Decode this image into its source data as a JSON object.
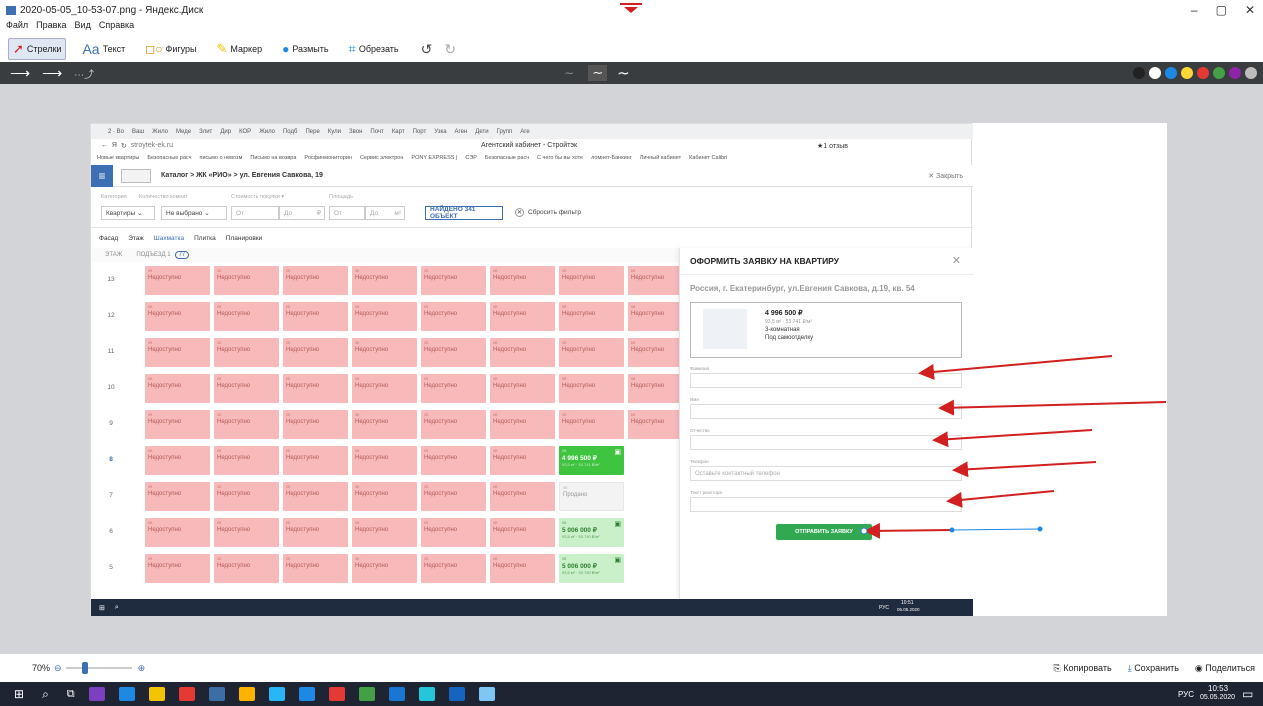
{
  "window": {
    "title": "2020-05-05_10-53-07.png - Яндекс.Диск",
    "controls": [
      "–",
      "▢",
      "✕"
    ]
  },
  "menu": [
    "Файл",
    "Правка",
    "Вид",
    "Справка"
  ],
  "toolbar": {
    "arrows": "Стрелки",
    "text": "Текст",
    "shapes": "Фигуры",
    "marker": "Маркер",
    "blur": "Размыть",
    "crop": "Обрезать"
  },
  "palette": [
    "#222222",
    "#ffffff",
    "#1e88e5",
    "#fdd835",
    "#e53935",
    "#43a047",
    "#8e24aa",
    "#bdbdbd"
  ],
  "browser": {
    "tabs": [
      "2 · Во",
      "Ваш",
      "Жило",
      "Меде",
      "Злит",
      "Дир",
      "КОР",
      "Жило",
      "Подб",
      "Пере",
      "Кули",
      "Звон",
      "Почт",
      "Карт",
      "Порт",
      "Узка",
      "Аген",
      "Дети",
      "Групп",
      "Аге"
    ],
    "url": "stroytek-ek.ru",
    "page_title": "Агентский кабинет - Стройтэк",
    "reviews": "★1 отзыв",
    "bookmarks": [
      "Новые квартиры",
      "Безопасные расч",
      "письмо о невозм",
      "Письмо на возвра",
      "Росфинмониторин",
      "Сервис электрон",
      "PONY EXPRESS |",
      "СЭР",
      "Безопасные расч",
      "С чего бы вы хоте",
      "ломнет-Банкинг",
      "Личный кабинет",
      "Кабинет Сalibri"
    ]
  },
  "site": {
    "breadcrumb": [
      "Каталог",
      "ЖК «РИО»",
      "ул. Евгения Савкова, 19"
    ],
    "close": "✕ Закрыть",
    "filters": {
      "labels": [
        "Категория",
        "Количество комнат",
        "Стоимость покупки ▾",
        "Площадь"
      ],
      "category": "Квартиры",
      "rooms": "Не выбрано",
      "from": "От",
      "to": "До",
      "rub": "₽",
      "m2": "м²",
      "found": "НАЙДЕНО 341 ОБЪЕКТ",
      "reset": "Сбросить фильтр"
    },
    "views": [
      "Фасад",
      "Этаж",
      "Шахматка",
      "Плитка",
      "Планировки"
    ],
    "floor_header": {
      "label": "ЭТАЖ",
      "entrance": "ПОДЪЕЗД 1",
      "count": "77"
    }
  },
  "floors": [
    {
      "num": "13",
      "cells": [
        "u",
        "u",
        "u",
        "u",
        "u",
        "u",
        "u",
        "u"
      ]
    },
    {
      "num": "12",
      "cells": [
        "u",
        "u",
        "u",
        "u",
        "u",
        "u",
        "u",
        "u"
      ]
    },
    {
      "num": "11",
      "cells": [
        "u",
        "u",
        "u",
        "u",
        "u",
        "u",
        "u",
        "u"
      ]
    },
    {
      "num": "10",
      "cells": [
        "u",
        "u",
        "u",
        "u",
        "u",
        "u",
        "u",
        "u"
      ]
    },
    {
      "num": "9",
      "cells": [
        "u",
        "u",
        "u",
        "u",
        "u",
        "u",
        "u",
        "u"
      ]
    },
    {
      "num": "8",
      "cells": [
        "u",
        "u",
        "u",
        "u",
        "u",
        "u",
        "sel"
      ]
    },
    {
      "num": "7",
      "cells": [
        "u",
        "u",
        "u",
        "u",
        "u",
        "u",
        "sold"
      ]
    },
    {
      "num": "6",
      "cells": [
        "u",
        "u",
        "u",
        "u",
        "u",
        "u",
        "av"
      ]
    },
    {
      "num": "5",
      "cells": [
        "u",
        "u",
        "u",
        "u",
        "u",
        "u",
        "av"
      ]
    }
  ],
  "cell_text": {
    "unavailable": "Недоступно",
    "sold": "Продано",
    "sel_price": "4 996 500 ₽",
    "sel_meta": "93,5 м² · 53 741 ₽/м²",
    "av_price": "5 006 000 ₽",
    "av_meta": "93,5 м² · 53 740 ₽/м²",
    "apt": "кв"
  },
  "modal": {
    "title": "ОФОРМИТЬ ЗАЯВКУ НА КВАРТИРУ",
    "address": "Россия, г. Екатеринбург, ул.Евгения Савкова, д.19, кв. 54",
    "card": {
      "price": "4 996 500 ₽",
      "meta": "93,5 м² · 53 741 ₽/м²",
      "rooms": "3-комнатная",
      "finish": "Под самоотделку"
    },
    "fields": [
      {
        "label": "Фамилия",
        "placeholder": ""
      },
      {
        "label": "Имя",
        "placeholder": ""
      },
      {
        "label": "Отчество",
        "placeholder": ""
      },
      {
        "label": "Телефон",
        "placeholder": "Оставьте контактный телефон"
      },
      {
        "label": "Текст риэлтора",
        "placeholder": ""
      }
    ],
    "submit": "ОТПРАВИТЬ ЗАЯВКУ"
  },
  "inner_taskbar": {
    "lang": "РУС",
    "time": "10:51",
    "date": "05.05.2020"
  },
  "zoom": {
    "value": "70%"
  },
  "actions": {
    "copy": "Копировать",
    "save": "Сохранить",
    "share": "Поделиться"
  },
  "taskbar": {
    "lang": "РУС",
    "time": "10:53",
    "date": "05.05.2020"
  }
}
